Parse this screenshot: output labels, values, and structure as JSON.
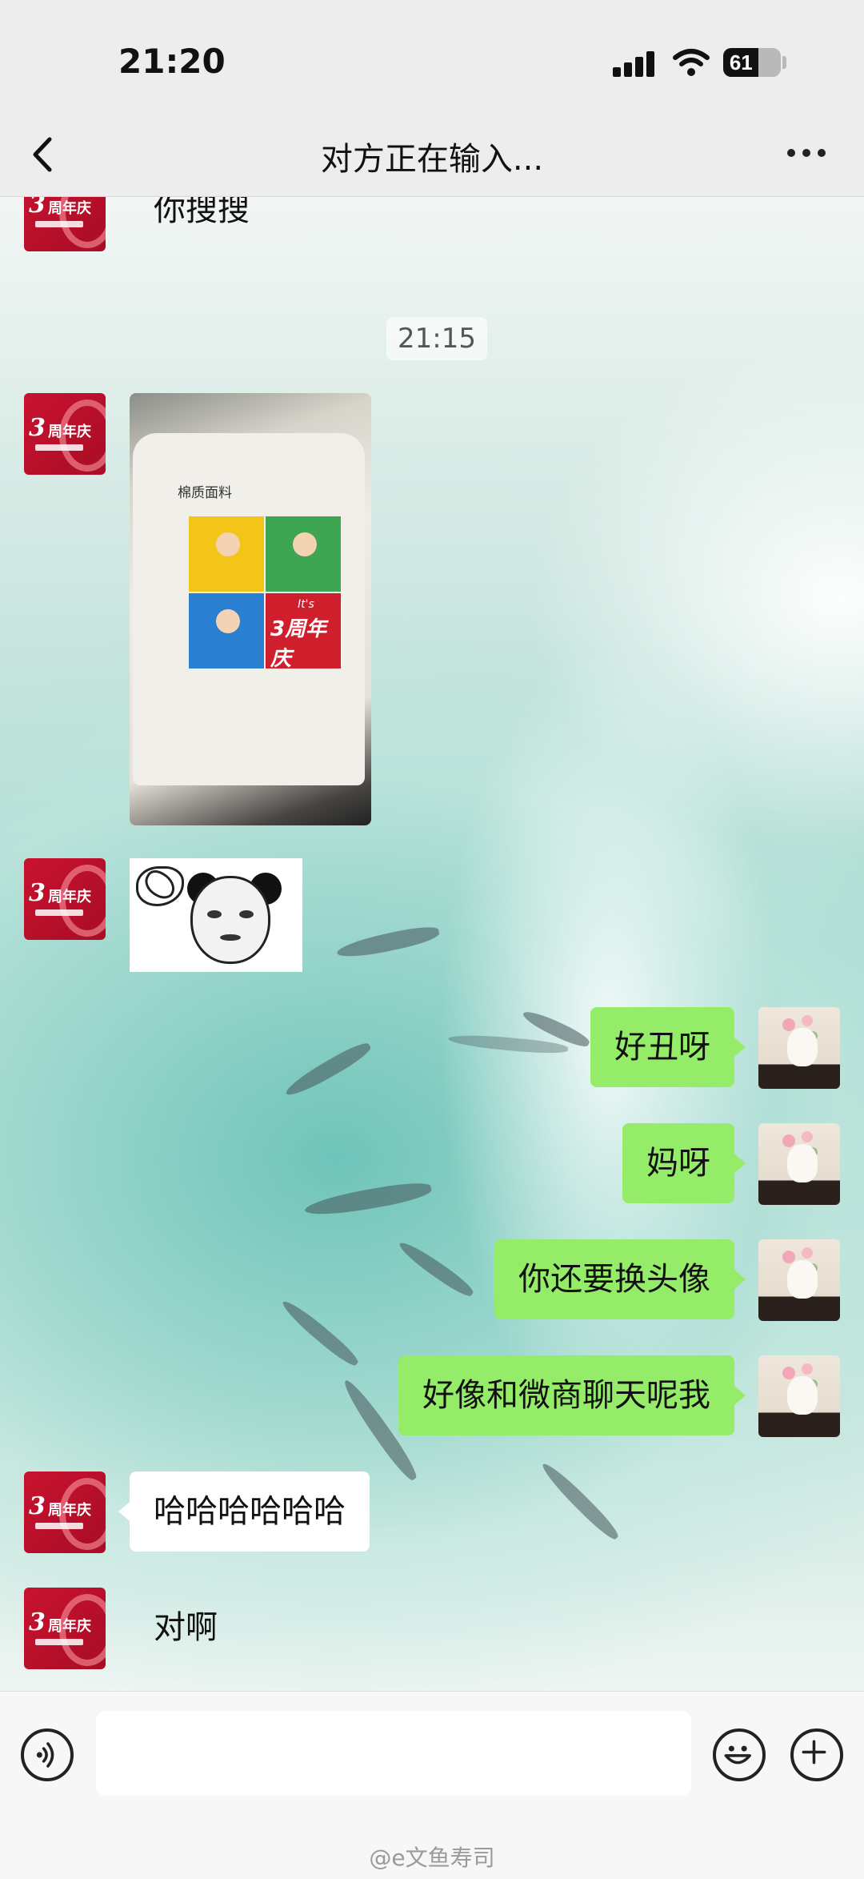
{
  "status_bar": {
    "time": "21:20",
    "battery_level": "61",
    "battery_fraction": 0.61
  },
  "header": {
    "title": "对方正在输入..."
  },
  "chat": {
    "timestamp": "21:15",
    "messages": [
      {
        "side": "left",
        "type": "text",
        "text": "你搜搜"
      },
      {
        "side": "left",
        "type": "image",
        "image_caption_text": "棉质面料",
        "image_logo_text": "3周年庆",
        "image_logo_prefix": "It's"
      },
      {
        "side": "left",
        "type": "sticker"
      },
      {
        "side": "right",
        "type": "text",
        "text": "好丑呀"
      },
      {
        "side": "right",
        "type": "text",
        "text": "妈呀"
      },
      {
        "side": "right",
        "type": "text",
        "text": "你还要换头像"
      },
      {
        "side": "right",
        "type": "text",
        "text": "好像和微商聊天呢我"
      },
      {
        "side": "left",
        "type": "text",
        "text": "哈哈哈哈哈哈"
      },
      {
        "side": "left",
        "type": "text",
        "text": "对啊"
      }
    ],
    "avatar_left": {
      "big_text": "3",
      "small_text": "周年庆"
    }
  },
  "input_bar": {
    "value": "",
    "watermark": "@e文鱼寿司"
  },
  "colors": {
    "outgoing_bubble": "#95ec69",
    "incoming_bubble": "#ffffff",
    "bar_background": "#ededed",
    "avatar_red": "#c8122f"
  },
  "icons": [
    "back-arrow-icon",
    "more-dots-icon",
    "voice-icon",
    "emoji-icon",
    "plus-icon",
    "signal-icon",
    "wifi-icon",
    "battery-icon"
  ]
}
